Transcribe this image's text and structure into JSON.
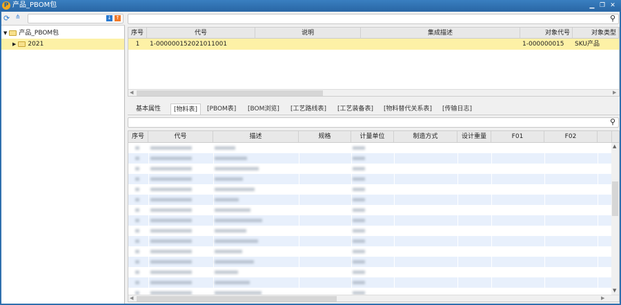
{
  "window": {
    "title": "产品_PBOM包",
    "minimize": "▁",
    "restore": "❐",
    "close": "✕"
  },
  "tree": {
    "root": "产品_PBOM包",
    "child": "2021"
  },
  "top_table": {
    "columns": [
      "序号",
      "代号",
      "说明",
      "集成描述",
      "对象代号",
      "对象类型"
    ],
    "rows": [
      [
        "1",
        "1-000000152021011001",
        "",
        "",
        "1-000000015",
        "SKU产品"
      ]
    ]
  },
  "tabs": [
    "基本属性",
    "[物料表]",
    "[PBOM表]",
    "[BOM浏览]",
    "[工艺路线表]",
    "[工艺装备表]",
    "[物料替代关系表]",
    "[传输日志]"
  ],
  "active_tab": 1,
  "bottom_table": {
    "columns": [
      "序号",
      "代号",
      "描述",
      "规格",
      "计量单位",
      "制造方式",
      "设计重量",
      "F01",
      "F02"
    ],
    "row_count": 15
  },
  "colors": {
    "title_bar": "#2a6aa8",
    "selected_row": "#fdf1a6",
    "alt_row": "#e8f0fc"
  }
}
